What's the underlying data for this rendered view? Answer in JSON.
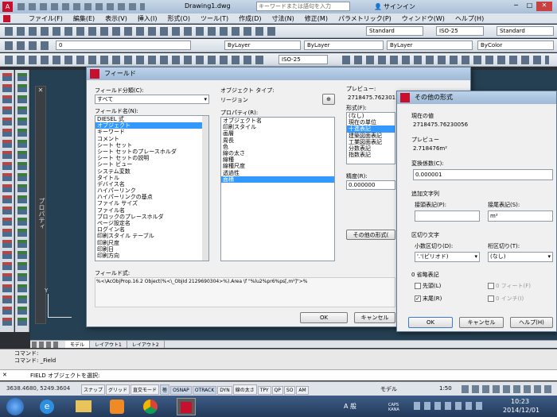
{
  "titlebar": {
    "file": "Drawing1.dwg",
    "search_placeholder": "キーワードまたは語句を入力",
    "signin": "サインイン"
  },
  "menu": [
    "ファイル(F)",
    "編集(E)",
    "表示(V)",
    "挿入(I)",
    "形式(O)",
    "ツール(T)",
    "作成(D)",
    "寸法(N)",
    "修正(M)",
    "パラメトリック(P)",
    "ウィンドウ(W)",
    "ヘルプ(H)"
  ],
  "styles": {
    "text_style": "Standard",
    "dim_style": "ISO-25",
    "table_style": "Standard"
  },
  "layers": {
    "layer": "0",
    "color": "ByLayer",
    "linetype": "ByLayer",
    "lineweight": "ByLayer",
    "plotstyle": "ByColor",
    "dim": "ISO-25"
  },
  "palette_label": "プロパティ",
  "layout_tabs": [
    "モデル",
    "レイアウト1",
    "レイアウト2"
  ],
  "command": {
    "line1": "コマンド:",
    "line2": "コマンド: _Field",
    "prompt": "FIELD オブジェクトを選択:"
  },
  "status": {
    "coords": "3638.4680, 5249.3604",
    "buttons": [
      "スナップ",
      "グリッド",
      "直交モード",
      "極",
      "OSNAP",
      "OTRACK",
      "DYN",
      "線の太さ",
      "TPY",
      "QP",
      "SO",
      "AM"
    ],
    "model": "モデル",
    "scale": "1:50"
  },
  "field_dialog": {
    "title": "フィールド",
    "category_label": "フィールド分類(C):",
    "category_value": "すべて",
    "names_label": "フィールド名(N):",
    "names": [
      "DIESEL 式",
      "オブジェクト",
      "キーワード",
      "コメント",
      "シート セット",
      "シート セットのプレースホルダ",
      "シート セットの説明",
      "シート ビュー",
      "システム変数",
      "タイトル",
      "デバイス名",
      "ハイパーリンク",
      "ハイパーリンクの基点",
      "ファイル サイズ",
      "ファイル名",
      "ブロックのプレースホルダ",
      "ページ設定名",
      "ログイン名",
      "印刷スタイル テーブル",
      "印刷尺度",
      "印刷日",
      "印刷方向"
    ],
    "names_selected": 1,
    "objtype_label": "オブジェクト タイプ:",
    "objtype_value": "リージョン",
    "props_label": "プロパティ(R):",
    "props": [
      "オブジェクト名",
      "印刷スタイル",
      "画層",
      "周長",
      "色",
      "線の太さ",
      "線種",
      "線種尺度",
      "透過性",
      "面積"
    ],
    "props_selected": 9,
    "preview_label": "プレビュー:",
    "preview_value": "2718475.762301",
    "format_label": "形式(F):",
    "formats": [
      "(なし)",
      "現在の単位",
      "十進表記",
      "建築図面表記",
      "工業図面表記",
      "分数表記",
      "指数表記"
    ],
    "formats_selected": 2,
    "precision_label": "精度(R):",
    "precision_value": "0.000000",
    "other_format_btn": "その他の形式(",
    "expr_label": "フィールド式:",
    "expr": "%<\\AcObjProp.16.2 Object(%<\\_ObjId 2129690304>%).Area \\f \"%lu2%pr6%ps[,m²]\">%",
    "ok": "OK",
    "cancel": "キャンセル"
  },
  "other_dialog": {
    "title": "その他の形式",
    "current_label": "現在の値",
    "current_value": "2718475.76230056",
    "preview_label": "プレビュー",
    "preview_value": "2.718476m²",
    "factor_label": "変換係数(C):",
    "factor_value": "0.000001",
    "addtext_label": "追加文字列",
    "prefix_label": "接頭表記(P):",
    "prefix_value": "",
    "suffix_label": "接尾表記(S):",
    "suffix_value": "m²",
    "sep_label": "区切り文字",
    "dec_label": "小数区切り(D):",
    "dec_value": "'.'(ピリオド)",
    "thousands_label": "桁区切り(T):",
    "thousands_value": "(なし)",
    "zero_label": "0 省略表記",
    "leading": "先頭(L)",
    "trailing": "末尾(R)",
    "feet": "0 フィート(F)",
    "inches": "0 インチ(I)",
    "ok": "OK",
    "cancel": "キャンセル",
    "help": "ヘルプ(H)"
  },
  "taskbar": {
    "time": "10:23",
    "date": "2014/12/01",
    "ime": "A 般",
    "lang": "CAPS KANA"
  }
}
